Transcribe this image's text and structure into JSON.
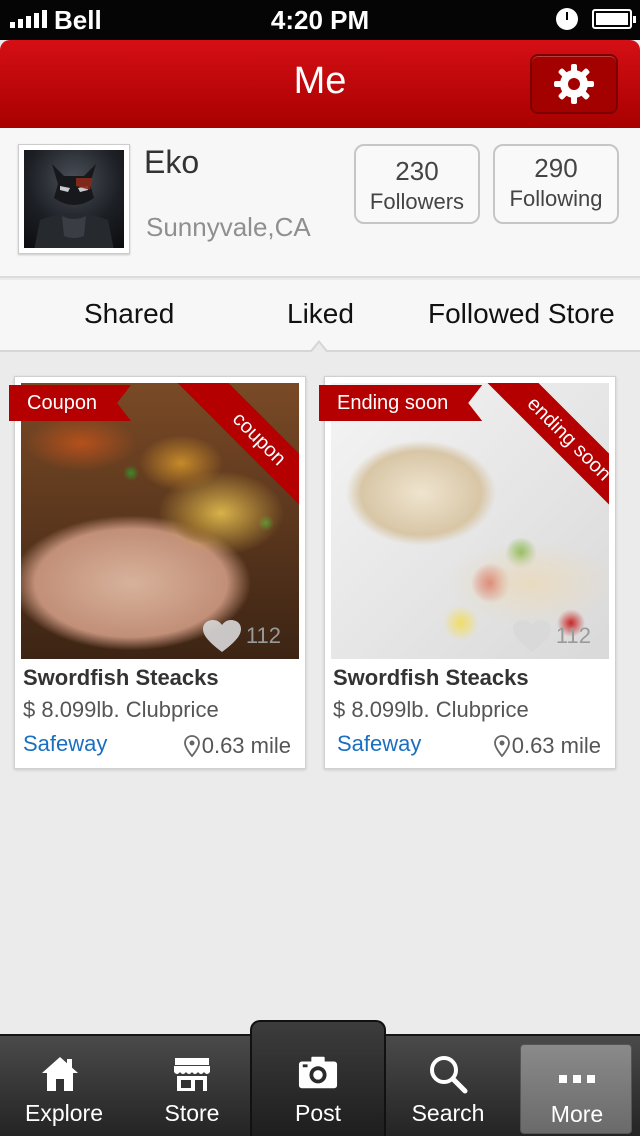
{
  "status_bar": {
    "carrier": "Bell",
    "time": "4:20 PM"
  },
  "nav": {
    "title": "Me",
    "settings_icon": "gear-icon"
  },
  "profile": {
    "name": "Eko",
    "location": "Sunnyvale,CA",
    "followers": {
      "count": "230",
      "label": "Followers"
    },
    "following": {
      "count": "290",
      "label": "Following"
    }
  },
  "tabs": [
    {
      "label": "Shared"
    },
    {
      "label": "Liked"
    },
    {
      "label": "Followed Store"
    }
  ],
  "selected_tab": "Liked",
  "cards": [
    {
      "tag": "Coupon",
      "corner": "coupon",
      "likes": "112",
      "title": "Swordfish Steacks",
      "price": "$ 8.099lb. Clubprice",
      "store": "Safeway",
      "distance": "0.63 mile"
    },
    {
      "tag": "Ending soon",
      "corner": "ending soon",
      "likes": "112",
      "title": "Swordfish Steacks",
      "price": "$ 8.099lb. Clubprice",
      "store": "Safeway",
      "distance": "0.63 mile"
    }
  ],
  "tabbar": [
    {
      "label": "Explore",
      "icon": "house-icon"
    },
    {
      "label": "Store",
      "icon": "storefront-icon"
    },
    {
      "label": "Post",
      "icon": "camera-icon"
    },
    {
      "label": "Search",
      "icon": "magnifier-icon"
    },
    {
      "label": "More",
      "icon": "more-dots-icon"
    }
  ],
  "colors": {
    "brand_red": "#c00000",
    "link_blue": "#1a6fc0"
  }
}
